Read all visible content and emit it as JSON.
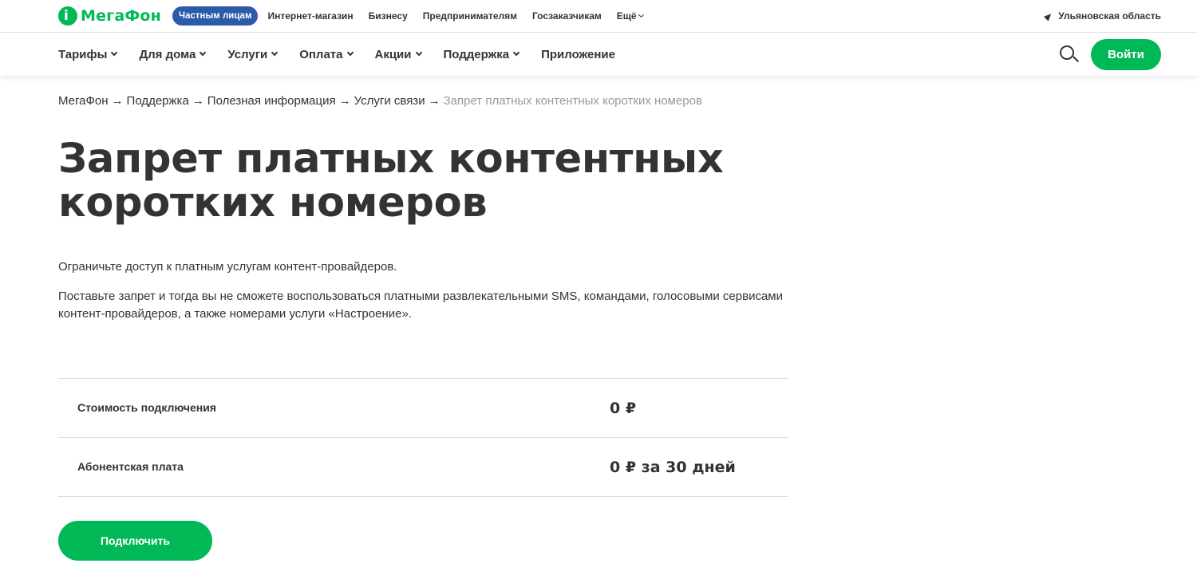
{
  "header": {
    "logo_text": "МегаФон",
    "segments": [
      {
        "label": "Частным лицам",
        "active": true
      },
      {
        "label": "Интернет-магазин"
      },
      {
        "label": "Бизнесу"
      },
      {
        "label": "Предпринимателям"
      },
      {
        "label": "Госзаказчикам"
      },
      {
        "label": "Ещё"
      }
    ],
    "region": "Ульяновская область"
  },
  "nav": {
    "items": [
      {
        "label": "Тарифы"
      },
      {
        "label": "Для дома"
      },
      {
        "label": "Услуги"
      },
      {
        "label": "Оплата"
      },
      {
        "label": "Акции"
      },
      {
        "label": "Поддержка"
      },
      {
        "label": "Приложение"
      }
    ],
    "login_label": "Войти",
    "search_icon": "search-icon"
  },
  "breadcrumb": {
    "items": [
      "МегаФон",
      "Поддержка",
      "Полезная информация",
      "Услуги связи"
    ],
    "current": "Запрет платных контентных коротких номеров",
    "separator": "→"
  },
  "page": {
    "title_line1": "Запрет платных контентных",
    "title_line2": "коротких номеров",
    "lead": "Ограничьте доступ к платным услугам контент-провайдеров.",
    "description_line1": "Поставьте запрет и тогда вы не сможете воспользоваться платными развлекательными SMS, командами, голосовыми сервисами",
    "description_line2": "контент-провайдеров, а также номерами услуги «Настроение».",
    "prices": [
      {
        "label": "Стоимость подключения",
        "value": "0 ₽"
      },
      {
        "label": "Абонентская плата",
        "value": "0 ₽ за 30 дней"
      }
    ],
    "connect_label": "Подключить"
  },
  "colors": {
    "brand_green": "#00b956",
    "segment_blue": "#2b5aa8",
    "text": "#333333",
    "muted": "#999999"
  }
}
